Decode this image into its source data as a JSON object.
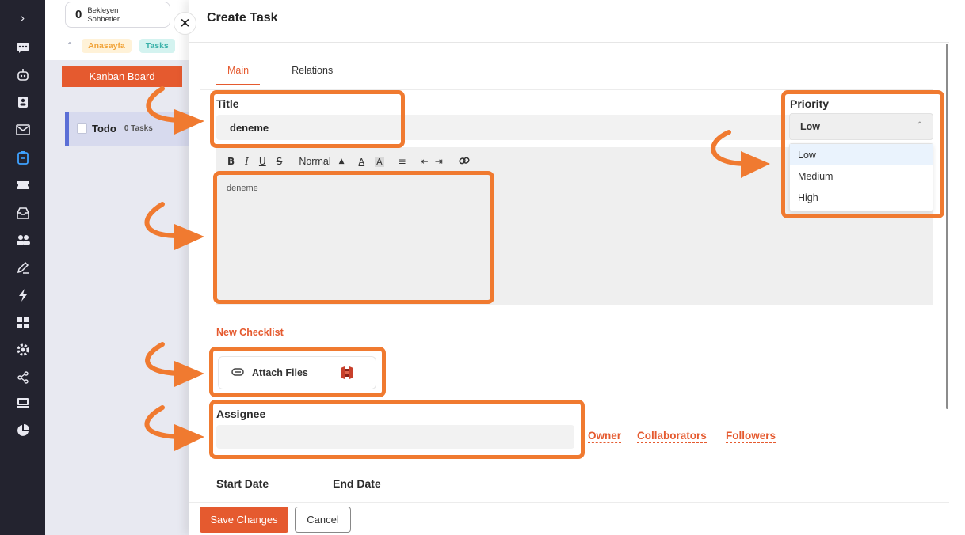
{
  "rail": {
    "icons": [
      "chevron-right",
      "chat",
      "bot",
      "contacts",
      "mail",
      "tasks",
      "tickets",
      "inbox",
      "team",
      "edit",
      "automation",
      "dashboard",
      "settings",
      "share",
      "devices",
      "reports"
    ],
    "active_index": 5,
    "active_color": "#3ea1ff"
  },
  "pending": {
    "count": "0",
    "label": "Bekleyen\nSohbetler"
  },
  "breadcrumb": {
    "home": "Anasayfa",
    "tasks": "Tasks"
  },
  "board": {
    "kanban_button": "Kanban Board",
    "column_title": "Todo",
    "column_count": "0 Tasks"
  },
  "modal": {
    "title": "Create Task",
    "tabs": [
      {
        "label": "Main",
        "active": true
      },
      {
        "label": "Relations",
        "active": false
      }
    ],
    "title_label": "Title",
    "title_value": "deneme",
    "editor": {
      "toolbar": {
        "bold": "B",
        "italic": "I",
        "underline": "U",
        "strike": "S",
        "format": "Normal"
      },
      "content": "deneme"
    },
    "priority": {
      "label": "Priority",
      "selected": "Low",
      "options": [
        "Low",
        "Medium",
        "High"
      ]
    },
    "new_checklist": "New Checklist",
    "attach_files": "Attach Files",
    "assignee_label": "Assignee",
    "roles": [
      "Owner",
      "Collaborators",
      "Followers"
    ],
    "start_date_label": "Start Date",
    "end_date_label": "End Date",
    "save_button": "Save Changes",
    "cancel_button": "Cancel"
  },
  "colors": {
    "accent": "#e55a2f",
    "annotation": "#f07a30",
    "rail_bg": "#23232f"
  }
}
